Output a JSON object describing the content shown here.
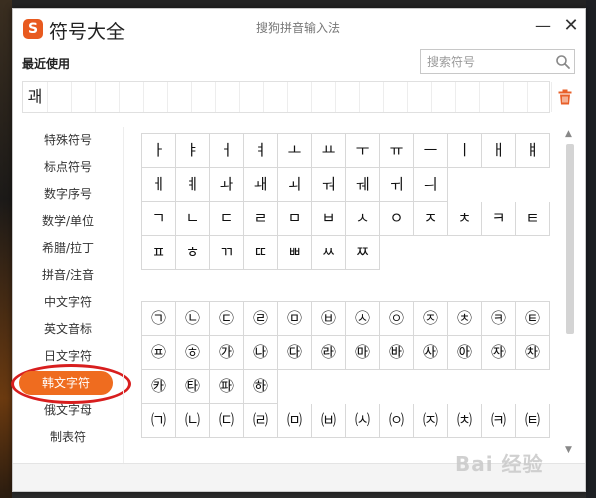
{
  "window": {
    "app_title": "符号大全",
    "logo_char": "S",
    "ime_name": "搜狗拼音输入法",
    "minimize": "—",
    "close": "✕"
  },
  "recent": {
    "label": "最近使用",
    "items": [
      "괘",
      "",
      "",
      "",
      "",
      "",
      "",
      "",
      "",
      "",
      "",
      "",
      "",
      "",
      "",
      "",
      "",
      "",
      "",
      "",
      "",
      ""
    ]
  },
  "search": {
    "placeholder": "搜索符号",
    "value": ""
  },
  "sidebar": {
    "items": [
      "特殊符号",
      "标点符号",
      "数字序号",
      "数学/单位",
      "希腊/拉丁",
      "拼音/注音",
      "中文字符",
      "英文音标",
      "日文字符",
      "韩文字符",
      "俄文字母",
      "制表符"
    ],
    "active_index": 9
  },
  "grid1": [
    "ㅏ",
    "ㅑ",
    "ㅓ",
    "ㅕ",
    "ㅗ",
    "ㅛ",
    "ㅜ",
    "ㅠ",
    "ㅡ",
    "ㅣ",
    "ㅐ",
    "ㅒ",
    "ㅔ",
    "ㅖ",
    "ㅘ",
    "ㅙ",
    "ㅚ",
    "ㅝ",
    "ㅞ",
    "ㅟ",
    "ㅢ",
    "",
    "",
    "",
    "ㄱ",
    "ㄴ",
    "ㄷ",
    "ㄹ",
    "ㅁ",
    "ㅂ",
    "ㅅ",
    "ㅇ",
    "ㅈ",
    "ㅊ",
    "ㅋ",
    "ㅌ",
    "ㅍ",
    "ㅎ",
    "ㄲ",
    "ㄸ",
    "ㅃ",
    "ㅆ",
    "ㅉ",
    "",
    "",
    "",
    "",
    ""
  ],
  "grid2": [
    "㉠",
    "㉡",
    "㉢",
    "㉣",
    "㉤",
    "㉥",
    "㉦",
    "㉧",
    "㉨",
    "㉩",
    "㉪",
    "㉫",
    "㉬",
    "㉭",
    "㉮",
    "㉯",
    "㉰",
    "㉱",
    "㉲",
    "㉳",
    "㉴",
    "㉵",
    "㉶",
    "㉷",
    "㉸",
    "㉹",
    "㉺",
    "㉻",
    "",
    "",
    "",
    "",
    "",
    "",
    "",
    "",
    "㈀",
    "㈁",
    "㈂",
    "㈃",
    "㈄",
    "㈅",
    "㈆",
    "㈇",
    "㈈",
    "㈉",
    "㈊",
    "㈋",
    "",
    "",
    "",
    "",
    "",
    "",
    "",
    "",
    "",
    "",
    "",
    ""
  ],
  "watermark": "Bai 经验",
  "colors": {
    "accent": "#ef6c1f",
    "highlight_circle": "#d81e1e"
  }
}
